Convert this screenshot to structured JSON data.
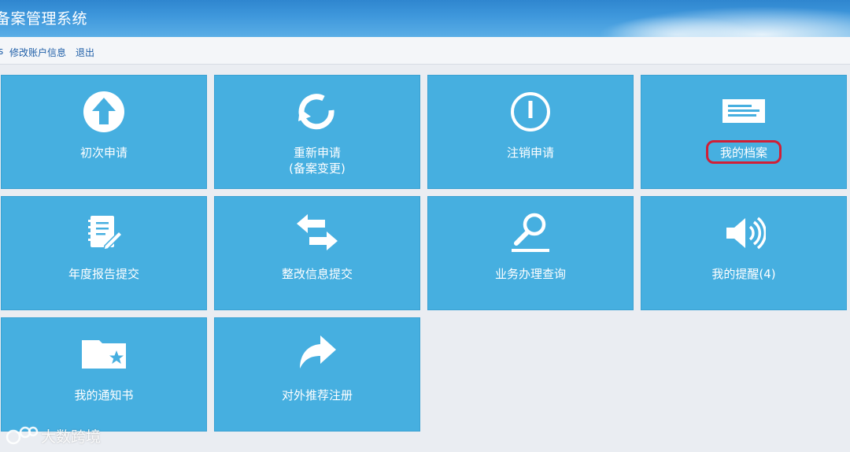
{
  "header": {
    "title": "备案管理系统"
  },
  "subnav": {
    "link_separator": "s",
    "edit_account": "修改账户信息",
    "logout": "退出"
  },
  "tiles": [
    {
      "label": "初次申请",
      "sublabel": "",
      "icon": "upload-arrow-icon"
    },
    {
      "label": "重新申请",
      "sublabel": "(备案变更)",
      "icon": "refresh-icon"
    },
    {
      "label": "注销申请",
      "sublabel": "",
      "icon": "power-icon"
    },
    {
      "label": "我的档案",
      "sublabel": "",
      "icon": "document-icon"
    },
    {
      "label": "年度报告提交",
      "sublabel": "",
      "icon": "notebook-pen-icon"
    },
    {
      "label": "整改信息提交",
      "sublabel": "",
      "icon": "swap-arrows-icon"
    },
    {
      "label": "业务办理查询",
      "sublabel": "",
      "icon": "magnifier-icon"
    },
    {
      "label": "我的提醒(4)",
      "sublabel": "",
      "icon": "speaker-icon"
    },
    {
      "label": "我的通知书",
      "sublabel": "",
      "icon": "folder-star-icon"
    },
    {
      "label": "对外推荐注册",
      "sublabel": "",
      "icon": "share-arrow-icon"
    }
  ],
  "colors": {
    "tile": "#46afe0",
    "header": "#3f98dc",
    "highlight": "#d11f36"
  },
  "watermark": "大数跨境"
}
